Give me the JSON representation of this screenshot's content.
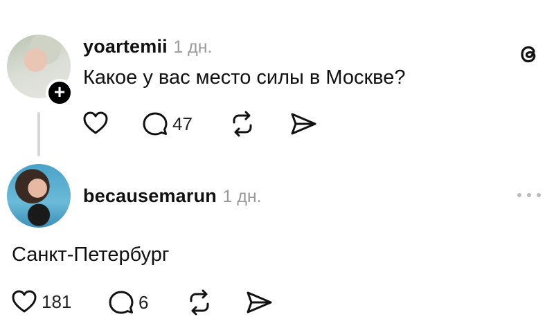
{
  "post": {
    "username": "yoartemii",
    "time": "1 дн.",
    "text": "Какое у вас место силы в Москве?",
    "reply_count": "47"
  },
  "reply": {
    "username": "becausemarun",
    "time": "1 дн.",
    "text": "Санкт-Петербург",
    "like_count": "181",
    "reply_count": "6"
  },
  "icons": [
    "threads-logo-icon",
    "heart-icon",
    "comment-icon",
    "repost-icon",
    "share-icon",
    "more-icon",
    "plus-icon"
  ]
}
